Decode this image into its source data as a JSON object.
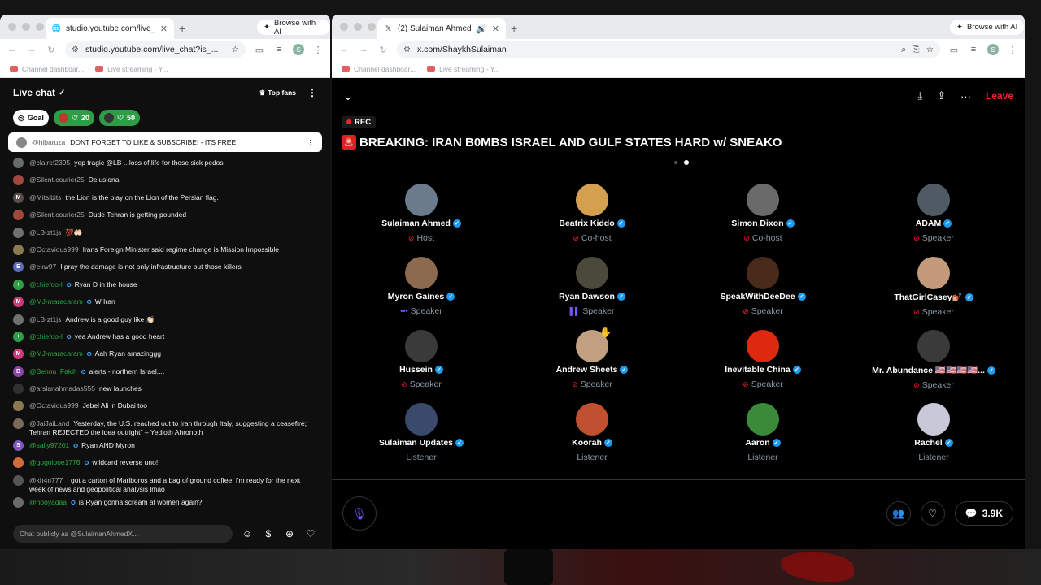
{
  "left_window": {
    "tab_title": "studio.youtube.com/live_chat",
    "ai_button": "Browse with AI",
    "url": "studio.youtube.com/live_chat?is_...",
    "bookmarks": [
      "Channel dashboar...",
      "Live streaming - Y..."
    ]
  },
  "right_window": {
    "tab_title": "(2) Sulaiman Ahmed (@Sł",
    "ai_button": "Browse with AI",
    "url": "x.com/ShaykhSulaiman",
    "bookmarks": [
      "Channel dashboar...",
      "Live streaming - Y..."
    ]
  },
  "chat": {
    "title": "Live chat",
    "top_fans": "Top fans",
    "goal_label": "Goal",
    "chip1_count": "20",
    "chip2_count": "50",
    "pinned_user": "@hibaruza",
    "pinned_text": "DONT FORGET TO LIKE & SUBSCRIBE! - ITS FREE",
    "messages": [
      {
        "user": "@clairef2395",
        "text": "yep tragic @LB ...loss of life for those sick pedos",
        "avatar_color": "#6a6a6a",
        "initial": "",
        "member": false
      },
      {
        "user": "@Silent.courier25",
        "text": "Delusional",
        "avatar_color": "#a0483c",
        "initial": "",
        "member": false
      },
      {
        "user": "@Mitsibits",
        "text": "the Lion is the play on the Lion of the Persian flag.",
        "avatar_color": "#5a4a48",
        "initial": "M",
        "member": false
      },
      {
        "user": "@Silent.courier25",
        "text": "Dude Tehran is getting pounded",
        "avatar_color": "#a0483c",
        "initial": "",
        "member": false
      },
      {
        "user": "@LB-zt1js",
        "text": "💯🤲🏻",
        "avatar_color": "#707070",
        "initial": "",
        "member": false
      },
      {
        "user": "@Octavious999",
        "text": "Irans Foreign Minister said regime change is Mission Impossible",
        "avatar_color": "#8a7a50",
        "initial": "",
        "member": false
      },
      {
        "user": "@ekw97",
        "text": "I pray the damage is not only infrastructure but those killers",
        "avatar_color": "#5c6bc0",
        "initial": "E",
        "member": false
      },
      {
        "user": "@chiefoo-l",
        "text": "Ryan D in the house",
        "avatar_color": "#2e9d45",
        "initial": "+",
        "member": true
      },
      {
        "user": "@MJ-maracaram",
        "text": "W Iran",
        "avatar_color": "#d03a7a",
        "initial": "M",
        "member": true
      },
      {
        "user": "@LB-zt1js",
        "text": "Andrew is a good guy like 👏🏻",
        "avatar_color": "#707070",
        "initial": "",
        "member": false
      },
      {
        "user": "@chiefoo-l",
        "text": "yea Andrew has a good heart",
        "avatar_color": "#2e9d45",
        "initial": "+",
        "member": true
      },
      {
        "user": "@MJ-maracaram",
        "text": "Aah Ryan amazinggg",
        "avatar_color": "#d03a7a",
        "initial": "M",
        "member": true
      },
      {
        "user": "@Bennu_Fakih",
        "text": "alerts - northern Israel....",
        "avatar_color": "#8e44ad",
        "initial": "B",
        "member": true
      },
      {
        "user": "@arslanahmadas555",
        "text": "new launches",
        "avatar_color": "#303030",
        "initial": "",
        "member": false
      },
      {
        "user": "@Octavious999",
        "text": "Jebel Ali in Dubai too",
        "avatar_color": "#8a7a50",
        "initial": "",
        "member": false
      },
      {
        "user": "@JaiJaiLand",
        "text": "Yesterday, the U.S. reached out to Iran through Italy, suggesting a ceasefire; Tehran REJECTED the idea outright\" – Yedioth Ahronoth",
        "avatar_color": "#7a6a5a",
        "initial": "",
        "member": false
      },
      {
        "user": "@sally97201",
        "text": "Ryan AND Myron",
        "avatar_color": "#7e57c2",
        "initial": "S",
        "member": true
      },
      {
        "user": "@gogolpoe1776",
        "text": "wildcard reverse uno!",
        "avatar_color": "#d06a3a",
        "initial": "",
        "member": true
      },
      {
        "user": "@kh4n777",
        "text": "I got a carton of Marlboros and a bag of ground coffee, i'm ready for the next week of news and geopolitical analysis lmao",
        "avatar_color": "#555555",
        "initial": "",
        "member": false
      },
      {
        "user": "@hooyadaa",
        "text": "is Ryan gonna scream at women again?",
        "avatar_color": "#6a6a6a",
        "initial": "",
        "member": true
      }
    ],
    "input_placeholder": "Chat publicly as @SulaimanAhmedX...",
    "badge_count": "1"
  },
  "space": {
    "leave_label": "Leave",
    "rec_label": "REC",
    "title": "BREAKING: IRAN B0MBS ISRAEL AND GULF STATES HARD w/ SNEAKO",
    "participants": [
      {
        "name": "Sulaiman Ahmed",
        "role": "Host",
        "verified": true,
        "role_icon": "muted",
        "avatar_color": "#6b7b8b"
      },
      {
        "name": "Beatrix Kiddo",
        "role": "Co-host",
        "verified": true,
        "role_icon": "muted",
        "avatar_color": "#d4a050"
      },
      {
        "name": "Simon Dixon",
        "role": "Co-host",
        "verified": true,
        "role_icon": "muted",
        "avatar_color": "#6a6a6a"
      },
      {
        "name": "ADAM",
        "role": "Speaker",
        "verified": true,
        "role_icon": "muted",
        "avatar_color": "#505a64"
      },
      {
        "name": "Myron Gaines",
        "role": "Speaker",
        "verified": true,
        "role_icon": "dots",
        "avatar_color": "#8b6a50"
      },
      {
        "name": "Ryan Dawson",
        "role": "Speaker",
        "verified": true,
        "role_icon": "speaking",
        "avatar_color": "#4a4a3a"
      },
      {
        "name": "SpeakWithDeeDee",
        "role": "Speaker",
        "verified": true,
        "role_icon": "muted",
        "avatar_color": "#4a2a1a"
      },
      {
        "name": "ThatGirlCasey💅🏼",
        "role": "Speaker",
        "verified": true,
        "role_icon": "muted",
        "avatar_color": "#c49a7a"
      },
      {
        "name": "Hussein",
        "role": "Speaker",
        "verified": true,
        "role_icon": "muted",
        "avatar_color": "#3a3a3a"
      },
      {
        "name": "Andrew Sheets",
        "role": "Speaker",
        "verified": true,
        "role_icon": "muted",
        "avatar_color": "#c0a080",
        "hand": true
      },
      {
        "name": "Inevitable China",
        "role": "Speaker",
        "verified": true,
        "role_icon": "muted",
        "avatar_color": "#de2910"
      },
      {
        "name": "Mr. Abundance 🇺🇸🇺🇸🇺🇸🇺🇸...",
        "role": "Speaker",
        "verified": true,
        "role_icon": "muted",
        "avatar_color": "#3a3a3a"
      },
      {
        "name": "Sulaiman Updates",
        "role": "Listener",
        "verified": true,
        "role_icon": "",
        "avatar_color": "#3a4a6a"
      },
      {
        "name": "Koorah",
        "role": "Listener",
        "verified": true,
        "role_icon": "",
        "avatar_color": "#c05030"
      },
      {
        "name": "Aaron",
        "role": "Listener",
        "verified": true,
        "role_icon": "",
        "avatar_color": "#3a8a3a"
      },
      {
        "name": "Rachel",
        "role": "Listener",
        "verified": true,
        "role_icon": "",
        "avatar_color": "#c8c8d8"
      }
    ],
    "listener_count": "3.9K"
  }
}
